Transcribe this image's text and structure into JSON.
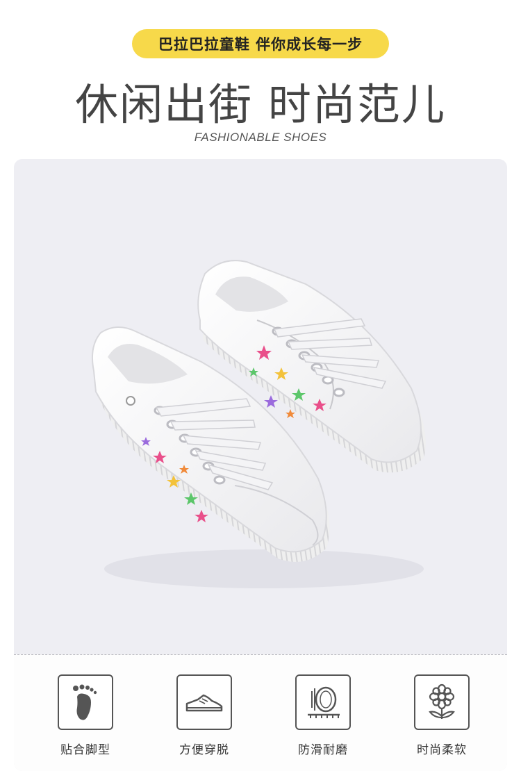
{
  "header": {
    "pill_text": "巴拉巴拉童鞋 伴你成长每一步",
    "headline": "休闲出街 时尚范儿",
    "subheadline": "FASHIONABLE SHOES"
  },
  "features": [
    {
      "label": "贴合脚型",
      "icon": "footprint-icon"
    },
    {
      "label": "方便穿脱",
      "icon": "shoe-icon"
    },
    {
      "label": "防滑耐磨",
      "icon": "sole-icon"
    },
    {
      "label": "时尚柔软",
      "icon": "flower-icon"
    }
  ],
  "colors": {
    "accent_yellow": "#f7d94a",
    "card_bg": "#eeeef3",
    "text_dark": "#444444"
  }
}
